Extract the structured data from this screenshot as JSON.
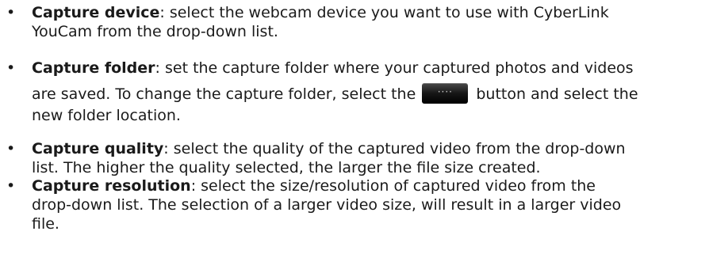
{
  "items": [
    {
      "term": "Capture device",
      "lines": [
        ": select the webcam device you want to use with CyberLink",
        "YouCam from the drop-down list."
      ]
    },
    {
      "term": "Capture folder",
      "line1": ": set the capture folder where your captured photos and videos",
      "line2_before": "are saved. To change the capture folder, select the ",
      "line2_after": " button and select the",
      "line3": "new folder location.",
      "button_icon": "ellipsis-icon"
    },
    {
      "term": "Capture quality",
      "lines": [
        ": select the quality of the captured video from the drop-down",
        "list. The higher the quality selected, the larger the file size created."
      ]
    },
    {
      "term": "Capture resolution",
      "lines": [
        ": select the size/resolution of captured video from the",
        "drop-down list. The selection of a larger video size, will result in a larger video",
        "file."
      ]
    }
  ],
  "bullet": "•",
  "button_color": "#161616"
}
